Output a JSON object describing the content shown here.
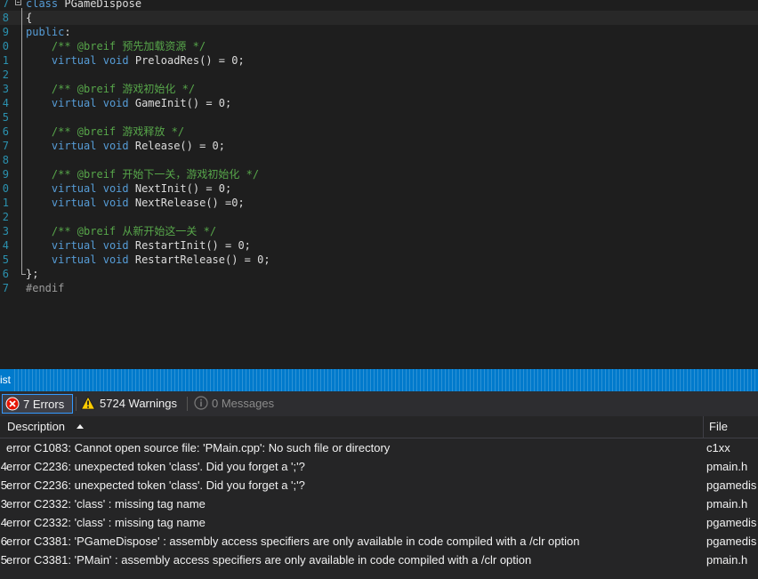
{
  "editor": {
    "lines": [
      {
        "num": "7",
        "tokens": [
          [
            "kw",
            "class"
          ],
          [
            "fn",
            " PGameDispose"
          ]
        ],
        "fold": "open"
      },
      {
        "num": "8",
        "tokens": [
          [
            "fn",
            "{"
          ]
        ],
        "current": true
      },
      {
        "num": "9",
        "tokens": [
          [
            "kw",
            "public"
          ],
          [
            "fn",
            ":"
          ]
        ]
      },
      {
        "num": "0",
        "tokens": [
          [
            "fn",
            "    "
          ],
          [
            "cm",
            "/** @breif 预先加载资源 */"
          ]
        ]
      },
      {
        "num": "1",
        "tokens": [
          [
            "fn",
            "    "
          ],
          [
            "kw",
            "virtual"
          ],
          [
            "fn",
            " "
          ],
          [
            "kw",
            "void"
          ],
          [
            "fn",
            " PreloadRes() = 0;"
          ]
        ]
      },
      {
        "num": "2",
        "tokens": []
      },
      {
        "num": "3",
        "tokens": [
          [
            "fn",
            "    "
          ],
          [
            "cm",
            "/** @breif 游戏初始化 */"
          ]
        ]
      },
      {
        "num": "4",
        "tokens": [
          [
            "fn",
            "    "
          ],
          [
            "kw",
            "virtual"
          ],
          [
            "fn",
            " "
          ],
          [
            "kw",
            "void"
          ],
          [
            "fn",
            " GameInit() = 0;"
          ]
        ]
      },
      {
        "num": "5",
        "tokens": []
      },
      {
        "num": "6",
        "tokens": [
          [
            "fn",
            "    "
          ],
          [
            "cm",
            "/** @breif 游戏释放 */"
          ]
        ]
      },
      {
        "num": "7",
        "tokens": [
          [
            "fn",
            "    "
          ],
          [
            "kw",
            "virtual"
          ],
          [
            "fn",
            " "
          ],
          [
            "kw",
            "void"
          ],
          [
            "fn",
            " Release() = 0;"
          ]
        ]
      },
      {
        "num": "8",
        "tokens": []
      },
      {
        "num": "9",
        "tokens": [
          [
            "fn",
            "    "
          ],
          [
            "cm",
            "/** @breif 开始下一关，游戏初始化 */"
          ]
        ]
      },
      {
        "num": "0",
        "tokens": [
          [
            "fn",
            "    "
          ],
          [
            "kw",
            "virtual"
          ],
          [
            "fn",
            " "
          ],
          [
            "kw",
            "void"
          ],
          [
            "fn",
            " NextInit() = 0;"
          ]
        ]
      },
      {
        "num": "1",
        "tokens": [
          [
            "fn",
            "    "
          ],
          [
            "kw",
            "virtual"
          ],
          [
            "fn",
            " "
          ],
          [
            "kw",
            "void"
          ],
          [
            "fn",
            " NextRelease() =0;"
          ]
        ]
      },
      {
        "num": "2",
        "tokens": []
      },
      {
        "num": "3",
        "tokens": [
          [
            "fn",
            "    "
          ],
          [
            "cm",
            "/** @breif 从新开始这一关 */"
          ]
        ]
      },
      {
        "num": "4",
        "tokens": [
          [
            "fn",
            "    "
          ],
          [
            "kw",
            "virtual"
          ],
          [
            "fn",
            " "
          ],
          [
            "kw",
            "void"
          ],
          [
            "fn",
            " RestartInit() = 0;"
          ]
        ]
      },
      {
        "num": "5",
        "tokens": [
          [
            "fn",
            "    "
          ],
          [
            "kw",
            "virtual"
          ],
          [
            "fn",
            " "
          ],
          [
            "kw",
            "void"
          ],
          [
            "fn",
            " RestartRelease() = 0;"
          ]
        ]
      },
      {
        "num": "6",
        "tokens": [
          [
            "fn",
            "};"
          ]
        ],
        "fold": "end"
      },
      {
        "num": "7",
        "tokens": [
          [
            "pp",
            "#endif"
          ]
        ]
      }
    ]
  },
  "error_list": {
    "title": "ist",
    "filters": {
      "errors_label": "7 Errors",
      "warnings_label": "5724 Warnings",
      "messages_label": "0 Messages"
    },
    "columns": {
      "description": "Description",
      "file": "File"
    },
    "rows": [
      {
        "num": "",
        "description": "error C1083: Cannot open source file: 'PMain.cpp': No such file or directory",
        "file": "c1xx"
      },
      {
        "num": "4",
        "description": "error C2236: unexpected token 'class'. Did you forget a ';'?",
        "file": "pmain.h"
      },
      {
        "num": "5",
        "description": "error C2236: unexpected token 'class'. Did you forget a ';'?",
        "file": "pgamedis"
      },
      {
        "num": "3",
        "description": "error C2332: 'class' : missing tag name",
        "file": "pmain.h"
      },
      {
        "num": "4",
        "description": "error C2332: 'class' : missing tag name",
        "file": "pgamedis"
      },
      {
        "num": "6",
        "description": "error C3381: 'PGameDispose' : assembly access specifiers are only available in code compiled with a /clr option",
        "file": "pgamedis"
      },
      {
        "num": "5",
        "description": "error C3381: 'PMain' : assembly access specifiers are only available in code compiled with a /clr option",
        "file": "pmain.h"
      }
    ]
  },
  "colors": {
    "accent": "#007acc",
    "keyword": "#569cd6",
    "comment": "#57a64a",
    "line_number": "#2b91af",
    "error_icon": "#e51400",
    "warning_icon": "#ffcc00"
  },
  "icons": {
    "errors": "error-circle-icon",
    "warnings": "warning-triangle-icon",
    "messages": "info-circle-icon",
    "sort": "sort-ascending-icon",
    "fold": "collapse-icon"
  }
}
